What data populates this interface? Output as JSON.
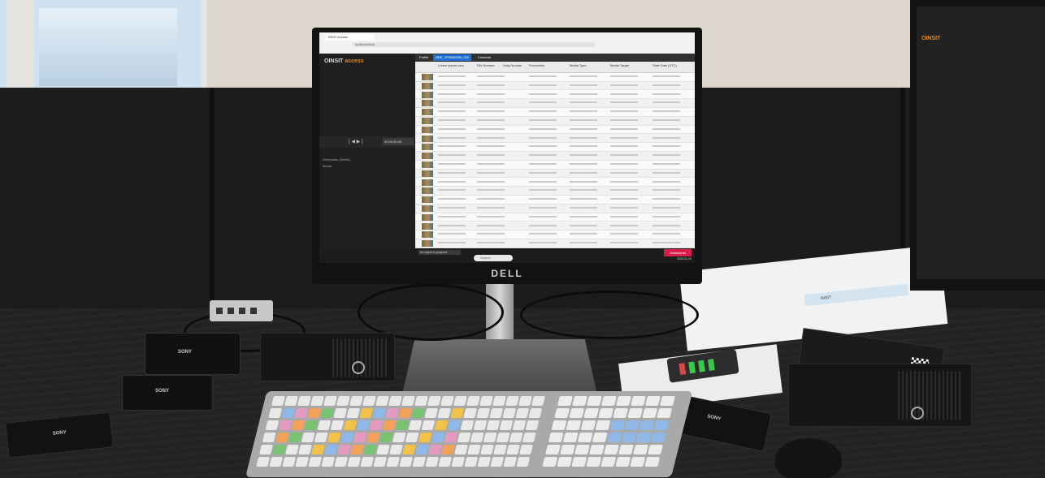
{
  "scene": {
    "monitor_brand": "DELL",
    "app_logo_prefix": "OINSIT",
    "app_logo_name": "access",
    "browser_tab": "INSIT Access",
    "address": "localhost/insit",
    "player_timecode": "00:00:00:00",
    "sidebar_labels": [
      "Directories (Subfd.)",
      "Media"
    ],
    "toolbar_tabs": [
      "Profile",
      "NRK_VPN000000_002",
      "Contents"
    ],
    "table_headers": [
      "Lorem ipsum cam",
      "File Number",
      "Unig Number",
      "Production",
      "Media Type",
      "Media Target",
      "Start Date (UTC)"
    ],
    "status_message": "No ingest in progress",
    "alert_button": "Ustawienia",
    "taskbar_search": "Search",
    "clock": "2025-01-01",
    "sony_label": "SONY",
    "paper_label": "INSIT"
  },
  "colors": {
    "accent_blue": "#1e6fd0",
    "alert_red": "#d81f4a",
    "logo_orange": "#e08a2a"
  }
}
